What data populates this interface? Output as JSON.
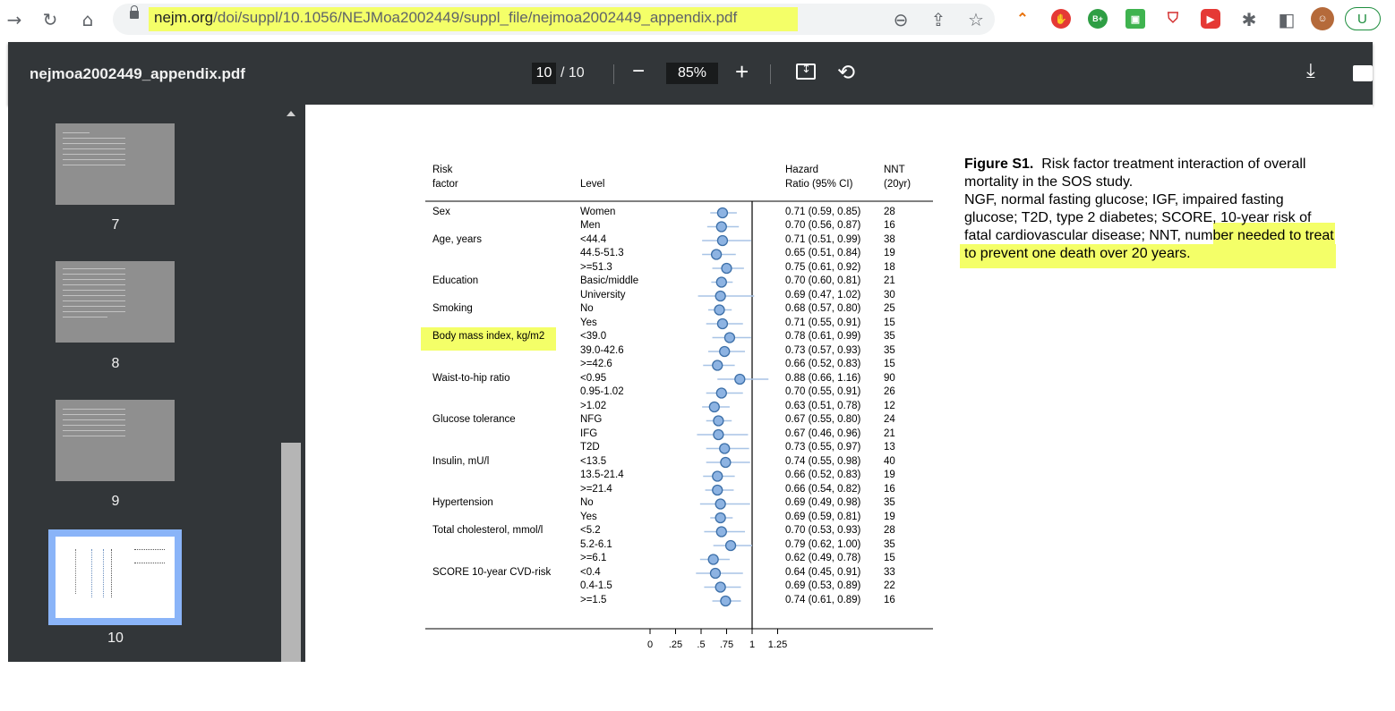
{
  "browser": {
    "url_domain": "nejm.org",
    "url_path": "/doi/suppl/10.1056/NEJMoa2002449/suppl_file/nejmoa2002449_appendix.pdf",
    "profile_initial": "U"
  },
  "pdf_viewer": {
    "doc_title": "nejmoa2002449_appendix.pdf",
    "current_page": "10",
    "total_pages": "/ 10",
    "zoom": "85%",
    "zoom_out_label": "−",
    "zoom_in_label": "+"
  },
  "sidebar": {
    "thumbnails": [
      {
        "label": "7"
      },
      {
        "label": "8"
      },
      {
        "label": "9"
      },
      {
        "label": "10",
        "selected": true
      }
    ]
  },
  "figure": {
    "headers": {
      "risk_factor_1": "Risk",
      "risk_factor_2": "factor",
      "level": "Level",
      "hr_1": "Hazard",
      "hr_2": "Ratio (95% CI)",
      "nnt_1": "NNT",
      "nnt_2": "(20yr)"
    },
    "caption_title": "Figure S1.",
    "caption_text": "Risk factor treatment interaction of overall mortality in the SOS study.",
    "caption_abbrev_1": "NGF, normal fasting glucose; IGF, impaired fasting glucose; T2D, type 2 diabetes; SCORE, 10-year risk of fatal cardiovascular disease;",
    "caption_abbrev_2": "NNT, number needed to treat to prevent one death over 20 years.",
    "axis_ticks": [
      "0",
      ".25",
      ".5",
      ".75",
      "1",
      "1.25"
    ]
  },
  "chart_data": {
    "type": "forest",
    "x_ticks": [
      0,
      0.25,
      0.5,
      0.75,
      1,
      1.25
    ],
    "xlim": [
      0,
      1.25
    ],
    "reference_line": 1,
    "rows": [
      {
        "factor": "Sex",
        "level": "Women",
        "hr": 0.71,
        "lo": 0.59,
        "hi": 0.85,
        "ci_text": "0.71 (0.59, 0.85)",
        "nnt": "28"
      },
      {
        "factor": "",
        "level": "Men",
        "hr": 0.7,
        "lo": 0.56,
        "hi": 0.87,
        "ci_text": "0.70 (0.56, 0.87)",
        "nnt": "16"
      },
      {
        "factor": "Age, years",
        "level": "<44.4",
        "hr": 0.71,
        "lo": 0.51,
        "hi": 0.99,
        "ci_text": "0.71 (0.51, 0.99)",
        "nnt": "38"
      },
      {
        "factor": "",
        "level": "44.5-51.3",
        "hr": 0.65,
        "lo": 0.51,
        "hi": 0.84,
        "ci_text": "0.65 (0.51, 0.84)",
        "nnt": "19"
      },
      {
        "factor": "",
        "level": ">=51.3",
        "hr": 0.75,
        "lo": 0.61,
        "hi": 0.92,
        "ci_text": "0.75 (0.61, 0.92)",
        "nnt": "18"
      },
      {
        "factor": "Education",
        "level": "Basic/middle",
        "hr": 0.7,
        "lo": 0.6,
        "hi": 0.81,
        "ci_text": "0.70 (0.60, 0.81)",
        "nnt": "21"
      },
      {
        "factor": "",
        "level": "University",
        "hr": 0.69,
        "lo": 0.47,
        "hi": 1.02,
        "ci_text": "0.69 (0.47, 1.02)",
        "nnt": "30"
      },
      {
        "factor": "Smoking",
        "level": "No",
        "hr": 0.68,
        "lo": 0.57,
        "hi": 0.8,
        "ci_text": "0.68 (0.57, 0.80)",
        "nnt": "25"
      },
      {
        "factor": "",
        "level": "Yes",
        "hr": 0.71,
        "lo": 0.55,
        "hi": 0.91,
        "ci_text": "0.71 (0.55, 0.91)",
        "nnt": "15"
      },
      {
        "factor": "Body mass index, kg/m2",
        "level": "<39.0",
        "hr": 0.78,
        "lo": 0.61,
        "hi": 0.99,
        "ci_text": "0.78 (0.61, 0.99)",
        "nnt": "35"
      },
      {
        "factor": "",
        "level": "39.0-42.6",
        "hr": 0.73,
        "lo": 0.57,
        "hi": 0.93,
        "ci_text": "0.73 (0.57, 0.93)",
        "nnt": "35"
      },
      {
        "factor": "",
        "level": ">=42.6",
        "hr": 0.66,
        "lo": 0.52,
        "hi": 0.83,
        "ci_text": "0.66 (0.52, 0.83)",
        "nnt": "15"
      },
      {
        "factor": "Waist-to-hip ratio",
        "level": "<0.95",
        "hr": 0.88,
        "lo": 0.66,
        "hi": 1.16,
        "ci_text": "0.88 (0.66, 1.16)",
        "nnt": "90"
      },
      {
        "factor": "",
        "level": "0.95-1.02",
        "hr": 0.7,
        "lo": 0.55,
        "hi": 0.91,
        "ci_text": "0.70 (0.55, 0.91)",
        "nnt": "26"
      },
      {
        "factor": "",
        "level": ">1.02",
        "hr": 0.63,
        "lo": 0.51,
        "hi": 0.78,
        "ci_text": "0.63 (0.51, 0.78)",
        "nnt": "12"
      },
      {
        "factor": "Glucose tolerance",
        "level": "NFG",
        "hr": 0.67,
        "lo": 0.55,
        "hi": 0.8,
        "ci_text": "0.67 (0.55, 0.80)",
        "nnt": "24"
      },
      {
        "factor": "",
        "level": "IFG",
        "hr": 0.67,
        "lo": 0.46,
        "hi": 0.96,
        "ci_text": "0.67 (0.46, 0.96)",
        "nnt": "21"
      },
      {
        "factor": "",
        "level": "T2D",
        "hr": 0.73,
        "lo": 0.55,
        "hi": 0.97,
        "ci_text": "0.73 (0.55, 0.97)",
        "nnt": "13"
      },
      {
        "factor": "Insulin, mU/l",
        "level": "<13.5",
        "hr": 0.74,
        "lo": 0.55,
        "hi": 0.98,
        "ci_text": "0.74 (0.55, 0.98)",
        "nnt": "40"
      },
      {
        "factor": "",
        "level": "13.5-21.4",
        "hr": 0.66,
        "lo": 0.52,
        "hi": 0.83,
        "ci_text": "0.66 (0.52, 0.83)",
        "nnt": "19"
      },
      {
        "factor": "",
        "level": ">=21.4",
        "hr": 0.66,
        "lo": 0.54,
        "hi": 0.82,
        "ci_text": "0.66 (0.54, 0.82)",
        "nnt": "16"
      },
      {
        "factor": "Hypertension",
        "level": "No",
        "hr": 0.69,
        "lo": 0.49,
        "hi": 0.98,
        "ci_text": "0.69 (0.49, 0.98)",
        "nnt": "35"
      },
      {
        "factor": "",
        "level": "Yes",
        "hr": 0.69,
        "lo": 0.59,
        "hi": 0.81,
        "ci_text": "0.69 (0.59, 0.81)",
        "nnt": "19"
      },
      {
        "factor": "Total cholesterol, mmol/l",
        "level": "<5.2",
        "hr": 0.7,
        "lo": 0.53,
        "hi": 0.93,
        "ci_text": "0.70 (0.53, 0.93)",
        "nnt": "28"
      },
      {
        "factor": "",
        "level": "5.2-6.1",
        "hr": 0.79,
        "lo": 0.62,
        "hi": 1.0,
        "ci_text": "0.79 (0.62, 1.00)",
        "nnt": "35"
      },
      {
        "factor": "",
        "level": ">=6.1",
        "hr": 0.62,
        "lo": 0.49,
        "hi": 0.78,
        "ci_text": "0.62 (0.49, 0.78)",
        "nnt": "15"
      },
      {
        "factor": "SCORE 10-year CVD-risk",
        "level": "<0.4",
        "hr": 0.64,
        "lo": 0.45,
        "hi": 0.91,
        "ci_text": "0.64 (0.45, 0.91)",
        "nnt": "33"
      },
      {
        "factor": "",
        "level": "0.4-1.5",
        "hr": 0.69,
        "lo": 0.53,
        "hi": 0.89,
        "ci_text": "0.69 (0.53, 0.89)",
        "nnt": "22"
      },
      {
        "factor": "",
        "level": ">=1.5",
        "hr": 0.74,
        "lo": 0.61,
        "hi": 0.89,
        "ci_text": "0.74 (0.61, 0.89)",
        "nnt": "16"
      }
    ]
  },
  "colors": {
    "marker_fill": "#8db3e2",
    "marker_stroke": "#3c6fa8",
    "ci_line": "#a8c4e6",
    "highlight": "#f4ff68",
    "viewer_bg": "#323639"
  }
}
